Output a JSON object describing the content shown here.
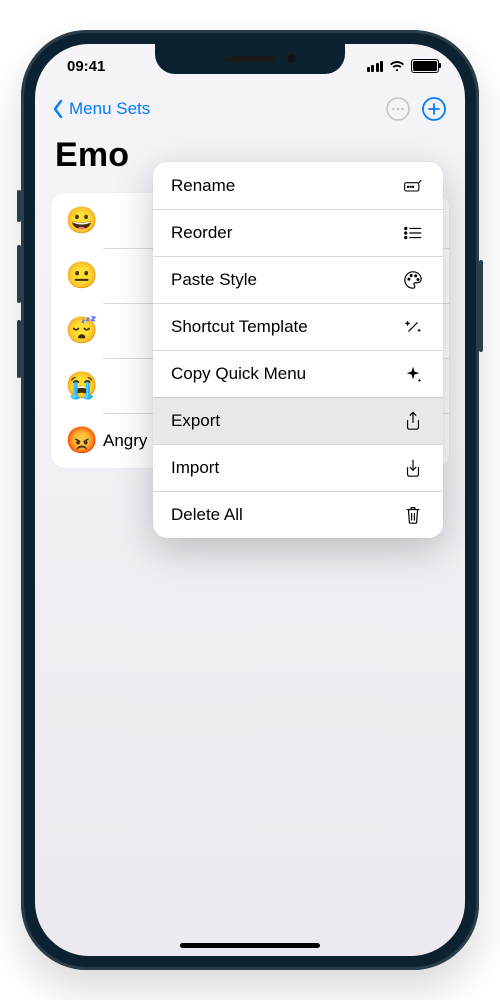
{
  "status": {
    "time": "09:41"
  },
  "nav": {
    "back_label": "Menu Sets"
  },
  "title": "Emo",
  "list": {
    "items": [
      {
        "emoji": "😀",
        "label": ""
      },
      {
        "emoji": "😐",
        "label": ""
      },
      {
        "emoji": "😴",
        "label": ""
      },
      {
        "emoji": "😭",
        "label": ""
      },
      {
        "emoji": "😡",
        "label": "Angry"
      }
    ]
  },
  "popover": {
    "items": [
      {
        "label": "Rename",
        "icon": "rename-icon",
        "selected": false
      },
      {
        "label": "Reorder",
        "icon": "list-icon",
        "selected": false
      },
      {
        "label": "Paste Style",
        "icon": "palette-icon",
        "selected": false
      },
      {
        "label": "Shortcut Template",
        "icon": "wand-icon",
        "selected": false
      },
      {
        "label": "Copy Quick Menu",
        "icon": "sparkle-icon",
        "selected": false
      },
      {
        "label": "Export",
        "icon": "share-icon",
        "selected": true
      },
      {
        "label": "Import",
        "icon": "download-icon",
        "selected": false
      },
      {
        "label": "Delete All",
        "icon": "trash-icon",
        "selected": false
      }
    ]
  }
}
